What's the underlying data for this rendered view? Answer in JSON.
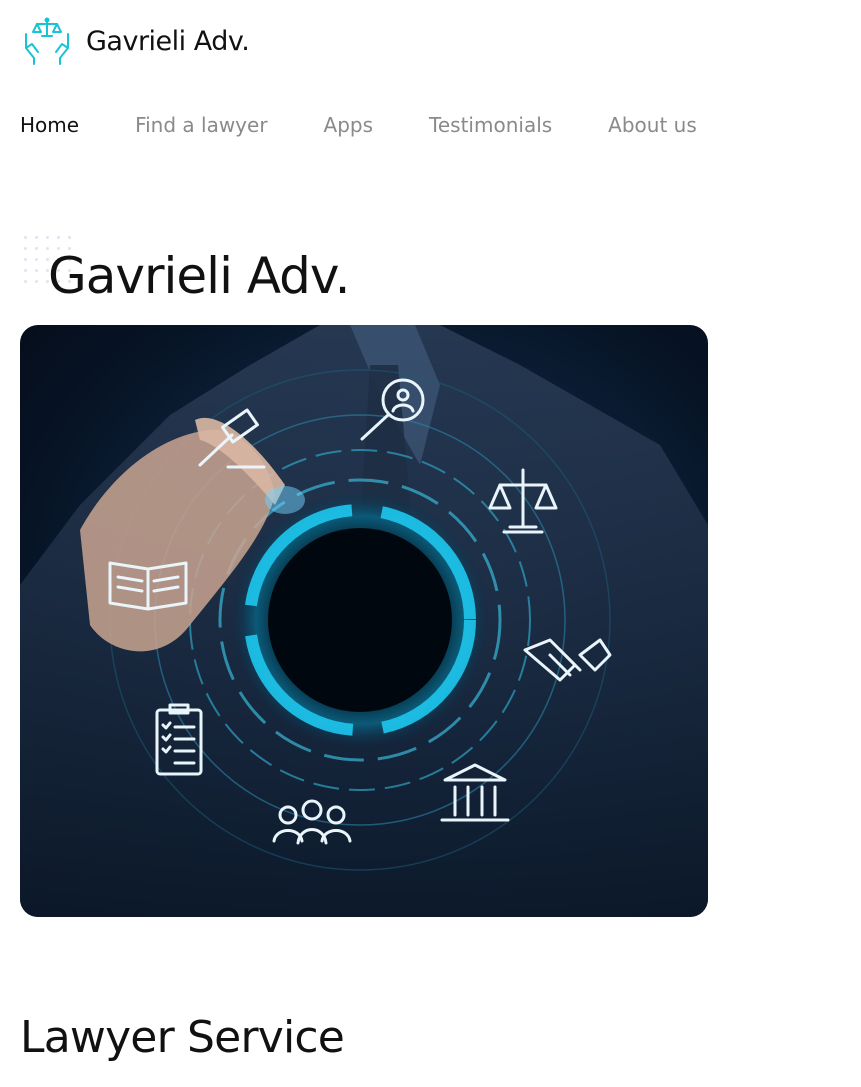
{
  "header": {
    "logo_text": "Gavrieli Adv.",
    "logo_icon": "scales-hands-icon",
    "accent_color": "#19c3d6"
  },
  "nav": {
    "items": [
      {
        "label": "Home",
        "active": true
      },
      {
        "label": "Find a lawyer",
        "active": false
      },
      {
        "label": "Apps",
        "active": false
      },
      {
        "label": "Testimonials",
        "active": false
      },
      {
        "label": "About us",
        "active": false
      }
    ]
  },
  "hero": {
    "title": "Gavrieli Adv.",
    "image_icons": [
      "gavel-icon",
      "search-person-icon",
      "scales-icon",
      "book-icon",
      "handshake-icon",
      "clipboard-icon",
      "courthouse-icon",
      "team-icon"
    ]
  },
  "services": {
    "title": "Lawyer Service"
  }
}
